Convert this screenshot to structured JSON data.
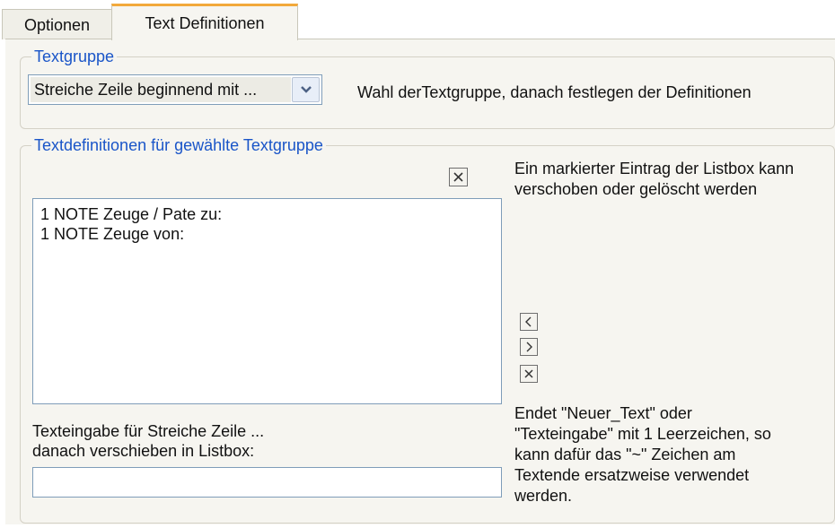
{
  "tabs": [
    {
      "label": "Optionen",
      "active": false
    },
    {
      "label": "Text Definitionen",
      "active": true
    }
  ],
  "textgruppe": {
    "legend": "Textgruppe",
    "combo_value": "Streiche Zeile beginnend mit ...",
    "hint": "Wahl derTextgruppe, danach festlegen der Definitionen"
  },
  "definitions": {
    "legend": "Textdefinitionen für gewählte Textgruppe",
    "listbox_hint": [
      "Ein markierter Eintrag der Listbox kann",
      "verschoben oder gelöscht werden"
    ],
    "list_items": [
      "1 NOTE Zeuge / Pate zu:",
      "1 NOTE Zeuge von:"
    ],
    "input_label": [
      "Texteingabe für Streiche Zeile ...",
      "danach verschieben in Listbox:"
    ],
    "input_value": "",
    "note": [
      "Endet \"Neuer_Text\" oder",
      "\"Texteingabe\" mit 1 Leerzeichen, so",
      "kann dafür das \"~\" Zeichen am",
      "Textende ersatzweise verwendet",
      "werden."
    ]
  },
  "icons": {
    "clear_list": "close-icon",
    "move_left": "chevron-left-icon",
    "move_right": "chevron-right-icon",
    "delete_entry": "close-icon",
    "combo_arrow": "chevron-down-icon"
  },
  "colors": {
    "legend_text": "#1a55c8",
    "active_tab_accent": "#f2a93b",
    "panel_bg": "#f6f5f0"
  }
}
